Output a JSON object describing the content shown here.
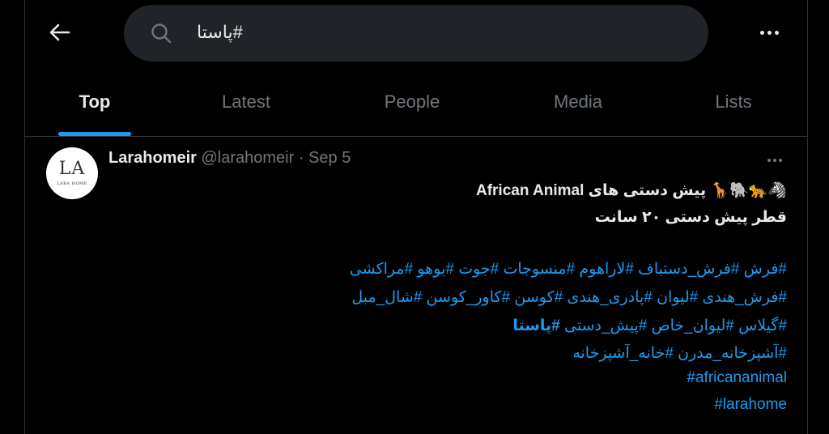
{
  "search": {
    "query": "#پاستا"
  },
  "tabs": [
    {
      "label": "Top",
      "active": true
    },
    {
      "label": "Latest"
    },
    {
      "label": "People"
    },
    {
      "label": "Media"
    },
    {
      "label": "Lists"
    }
  ],
  "tweet": {
    "avatar_text": "LA",
    "avatar_subtext": "LARA HOME",
    "display_name": "Larahomeir",
    "handle": "@larahomeir",
    "separator": "·",
    "date": "Sep 5",
    "line1": "🦓🐆🐘🦒 پیش دستی های African Animal",
    "line2": "قطر پیش دستی ۲۰ سانت",
    "tags1": "#فرش #فرش_دستباف #لاراهوم #منسوجات #جوت #بوهو #مراکشی",
    "tags2": "#فرش_هندی #لیوان #پادری_هندی #کوسن #کاور_کوسن #شال_مبل",
    "tags3_before": "#گیلاس #لیوان_خاص #پیش_دستی",
    "tags3_highlight": "#پاستا",
    "tags4": "#آشپزخانه_مدرن #خانه_آشپزخانه",
    "tags5": "#africananimal",
    "tags6": "#larahome"
  },
  "colors": {
    "accent": "#1d9bf0",
    "background": "#000000",
    "muted": "#71767b",
    "search_bg": "#202327"
  }
}
